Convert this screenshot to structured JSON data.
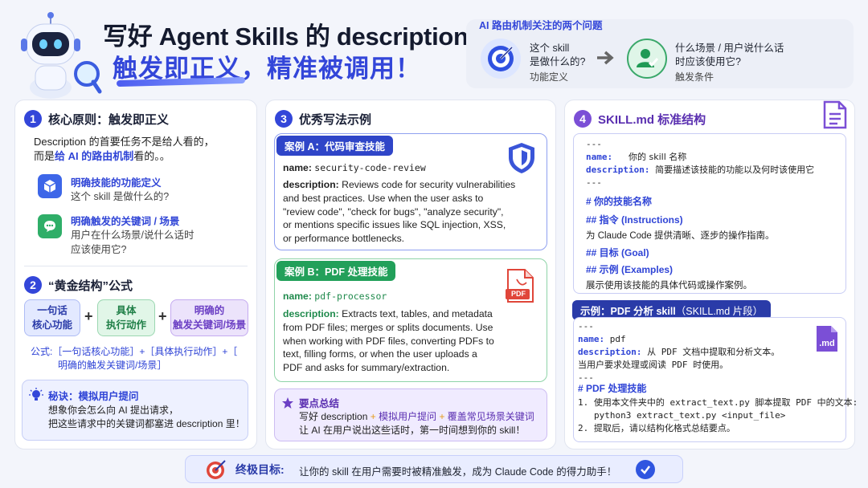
{
  "header": {
    "title_line1": "写好 Agent Skills 的 description",
    "title_line2": "触发即正义，精准被调用！"
  },
  "routing": {
    "title": "AI 路由机制关注的两个问题",
    "q1_line1": "这个 skill",
    "q1_line2": "是做什么的?",
    "q1_sub": "功能定义",
    "q2_line1": "什么场景 / 用户说什么话",
    "q2_line2": "时应该使用它?",
    "q2_sub": "触发条件"
  },
  "section1": {
    "num": "1",
    "title": "核心原则：触发即正义",
    "desc_line1": "Description 的首要任务不是给人看的，",
    "desc_line2_a": "而是",
    "desc_line2_b": "给 AI 的路由机制",
    "desc_line2_c": "看的。。",
    "item1_title": "明确技能的功能定义",
    "item1_sub": "这个 skill 是做什么的?",
    "item2_title": "明确触发的关键词 / 场景",
    "item2_sub1": "用户在什么场景/说什么话时",
    "item2_sub2": "应该使用它?"
  },
  "section2": {
    "num": "2",
    "title": "“黄金结构”公式",
    "chip1_l1": "一句话",
    "chip1_l2": "核心功能",
    "chip2_l1": "具体",
    "chip2_l2": "执行动作",
    "chip3_l1": "明确的",
    "chip3_l2": "触发关键词/场景",
    "plus": "+",
    "formula_l1": "公式:［一句话核心功能］+［具体执行动作］+［",
    "formula_l2": "明确的触发关键词/场景］",
    "tip_title": "秘诀：模拟用户提问",
    "tip_l1": "想象你会怎么向 AI 提出请求，",
    "tip_l2": "把这些请求中的关键词都塞进 description 里！"
  },
  "section3": {
    "num": "3",
    "title": "优秀写法示例",
    "caseA_tag": "案例 A：代码审查技能",
    "caseA_name_label": "name:",
    "caseA_name": "security-code-review",
    "caseA_desc_label": "description:",
    "caseA_desc_l1": "Reviews code for security vulnerabilities",
    "caseA_desc_l2": "and best practices. Use when the user asks to",
    "caseA_desc_l3": "\"review code\", \"check for bugs\", \"analyze security\",",
    "caseA_desc_l4": "or mentions specific issues like SQL injection, XSS,",
    "caseA_desc_l5": "or performance bottlenecks.",
    "caseB_tag": "案例 B：PDF 处理技能",
    "caseB_name_label": "name:",
    "caseB_name": "pdf-processor",
    "caseB_desc_label": "description:",
    "caseB_desc_l1": "Extracts text, tables, and metadata",
    "caseB_desc_l2": "from PDF files; merges or splits documents. Use",
    "caseB_desc_l3": "when working with PDF files, converting PDFs to",
    "caseB_desc_l4": "text, filling forms, or when the user uploads a",
    "caseB_desc_l5": "PDF and asks for summary/extraction.",
    "pdf_badge": "PDF",
    "summary_title": "要点总结",
    "summary_l1_a": "写好 description",
    "summary_l1_plus1": "+",
    "summary_l1_b": "模拟用户提问",
    "summary_l1_plus2": "+",
    "summary_l1_c": "覆盖常见场景关键词",
    "summary_l2": "让 AI 在用户说出这些话时，第一时间想到你的 skill！"
  },
  "section4": {
    "num": "4",
    "title": "SKILL.md 标准结构",
    "s_l1": "---",
    "s_name_label": "name:",
    "s_name_val": "你的 skill 名称",
    "s_desc_label": "description:",
    "s_desc_val": "简要描述该技能的功能以及何时该使用它",
    "s_l4": "---",
    "h1": "# 你的技能名称",
    "h2": "## 指令 (Instructions)",
    "h2_sub": "为 Claude Code 提供清晰、逐步的操作指南。",
    "h3": "## 目标 (Goal)",
    "h4": "## 示例 (Examples)",
    "h4_sub": "展示使用该技能的具体代码或操作案例。",
    "ex_tag_a": "示例：PDF 分析 skill",
    "ex_tag_b": "（SKILL.md 片段）",
    "e_l1": "---",
    "e_name_label": "name:",
    "e_name_val": "pdf",
    "e_desc_label": "description:",
    "e_desc_val": "从 PDF 文档中提取和分析文本。",
    "e_l4": "当用户要求处理或阅读 PDF 时使用。",
    "e_l5": "---",
    "e_h": "# PDF 处理技能",
    "e_l7": "1. 使用本文件夹中的 extract_text.py 脚本提取 PDF 中的文本:",
    "e_l8": "python3 extract_text.py <input_file>",
    "e_l9": "2. 提取后，请以结构化格式总结要点。",
    "md_badge": ".md"
  },
  "footer": {
    "label": "终极目标:",
    "text": "让你的 skill 在用户需要时被精准触发，成为 Claude Code 的得力助手！"
  },
  "colors": {
    "primary": "#3346d9",
    "green": "#25a05a",
    "purple": "#7b4fd6",
    "navy": "#1f3aa8"
  }
}
